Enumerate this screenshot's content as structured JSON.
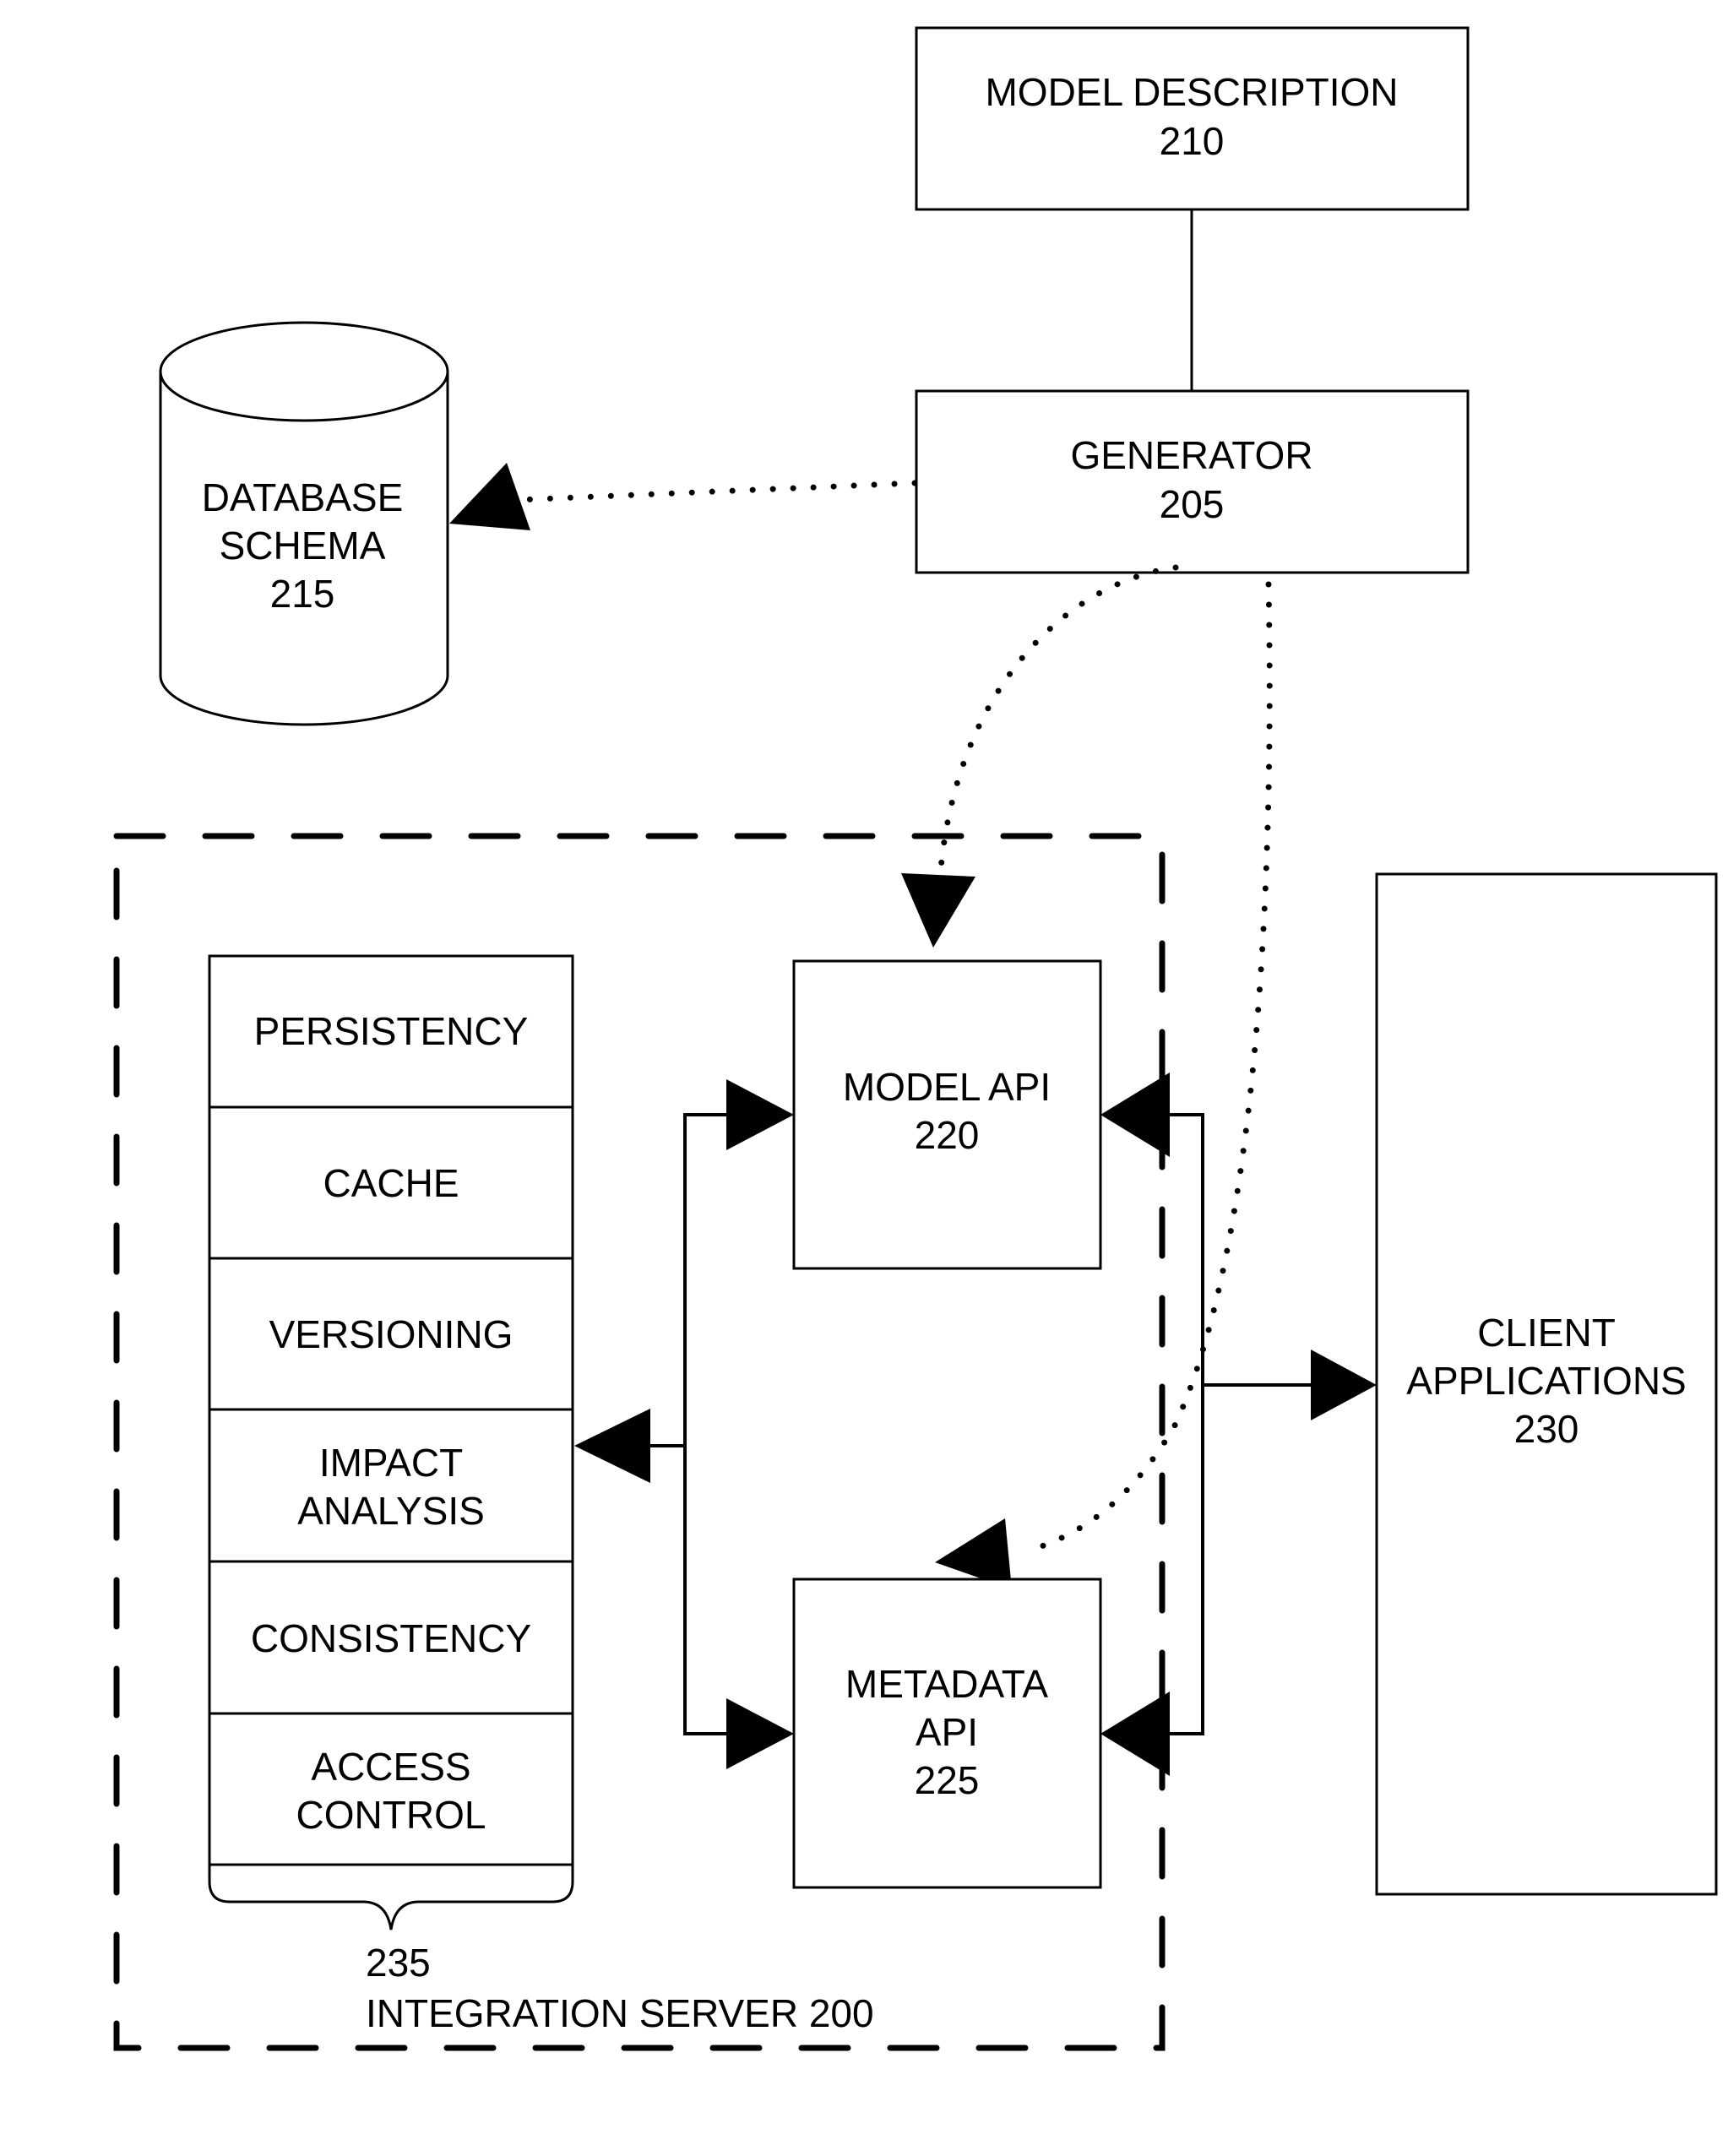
{
  "figure": {
    "nodes": {
      "model_description": {
        "title": "MODEL DESCRIPTION",
        "ref": "210"
      },
      "generator": {
        "title": "GENERATOR",
        "ref": "205"
      },
      "database_schema": {
        "line1": "DATABASE",
        "line2": "SCHEMA",
        "ref": "215"
      },
      "model_api": {
        "title": "MODEL API",
        "ref": "220"
      },
      "metadata_api": {
        "line1": "METADATA",
        "line2": "API",
        "ref": "225"
      },
      "client_applications": {
        "line1": "CLIENT",
        "line2": "APPLICATIONS",
        "ref": "230"
      }
    },
    "services_stack": {
      "ref": "235",
      "items": [
        {
          "lines": [
            "PERSISTENCY"
          ]
        },
        {
          "lines": [
            "CACHE"
          ]
        },
        {
          "lines": [
            "VERSIONING"
          ]
        },
        {
          "lines": [
            "IMPACT",
            "ANALYSIS"
          ]
        },
        {
          "lines": [
            "CONSISTENCY"
          ]
        },
        {
          "lines": [
            "ACCESS",
            "CONTROL"
          ]
        }
      ]
    },
    "container": {
      "label": "INTEGRATION SERVER 200"
    },
    "edges": [
      {
        "from": "model_description",
        "to": "generator",
        "style": "solid",
        "arrow": "none"
      },
      {
        "from": "generator",
        "to": "database_schema",
        "style": "dotted",
        "arrow": "to"
      },
      {
        "from": "generator",
        "to": "model_api",
        "style": "dotted",
        "arrow": "to"
      },
      {
        "from": "generator",
        "to": "metadata_api",
        "style": "dotted",
        "arrow": "to"
      },
      {
        "from": "api_bus",
        "to": "model_api",
        "style": "solid",
        "arrow": "to"
      },
      {
        "from": "api_bus",
        "to": "metadata_api",
        "style": "solid",
        "arrow": "to"
      },
      {
        "from": "api_bus",
        "to": "services_stack",
        "style": "solid",
        "arrow": "to"
      },
      {
        "from": "client_bus",
        "to": "model_api",
        "style": "solid",
        "arrow": "to"
      },
      {
        "from": "client_bus",
        "to": "metadata_api",
        "style": "solid",
        "arrow": "to"
      },
      {
        "from": "client_bus",
        "to": "client_applications",
        "style": "solid",
        "arrow": "to"
      }
    ]
  }
}
